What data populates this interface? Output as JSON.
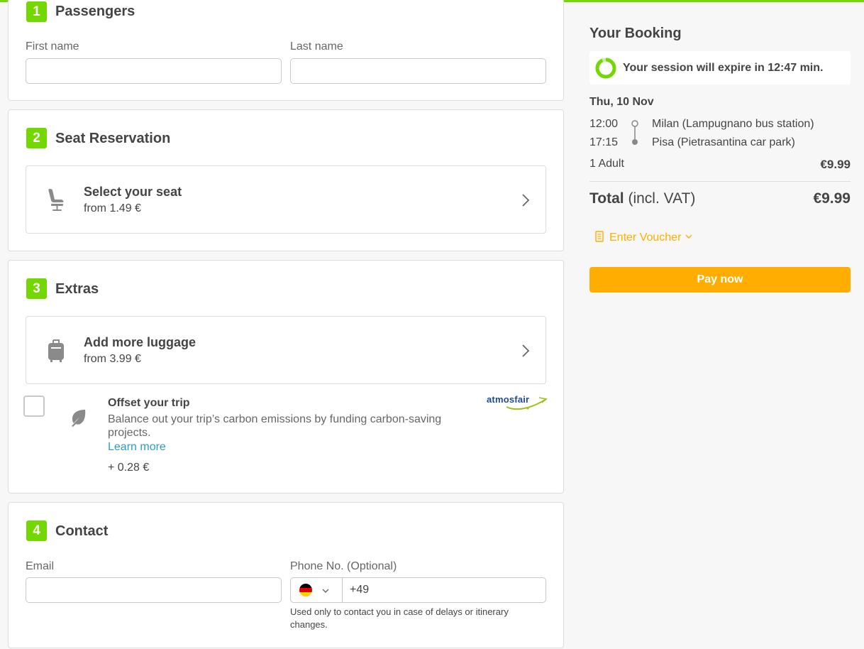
{
  "colors": {
    "accent_green": "#73d700",
    "accent_orange": "#ffad00",
    "link_blue": "#2b9cc8"
  },
  "passengers": {
    "step": "1",
    "title": "Passengers",
    "first_name_label": "First name",
    "first_name_value": "",
    "last_name_label": "Last name",
    "last_name_value": ""
  },
  "seat": {
    "step": "2",
    "title": "Seat Reservation",
    "option_title": "Select your seat",
    "option_price": "from 1.49 €",
    "icon": "seat-icon"
  },
  "extras": {
    "step": "3",
    "title": "Extras",
    "luggage_title": "Add more luggage",
    "luggage_price": "from 3.99 €",
    "luggage_icon": "luggage-icon",
    "offset": {
      "checked": false,
      "title": "Offset your trip",
      "description": "Balance out your trip’s carbon emissions by funding carbon-saving projects.",
      "learn_more": "Learn more",
      "price": "+ 0.28 €",
      "partner_logo": "atmosfair",
      "icon": "leaf-icon"
    }
  },
  "contact": {
    "step": "4",
    "title": "Contact",
    "email_label": "Email",
    "email_value": "",
    "phone_label": "Phone No. (Optional)",
    "phone_country_flag": "germany-flag-icon",
    "phone_prefix": "+49",
    "phone_note": "Used only to contact you in case of delays or itinerary changes."
  },
  "booking": {
    "title": "Your Booking",
    "session_text": "Your session will expire in 12:47 min.",
    "date": "Thu, 10 Nov",
    "departure_time": "12:00",
    "departure_stop": "Milan (Lampugnano bus station)",
    "arrival_time": "17:15",
    "arrival_stop": "Pisa (Pietrasantina car park)",
    "passenger_label": "1 Adult",
    "passenger_price": "€9.99",
    "total_label": "Total",
    "total_suffix": "(incl. VAT)",
    "total_price": "€9.99",
    "voucher_label": "Enter Voucher",
    "pay_label": "Pay now"
  }
}
